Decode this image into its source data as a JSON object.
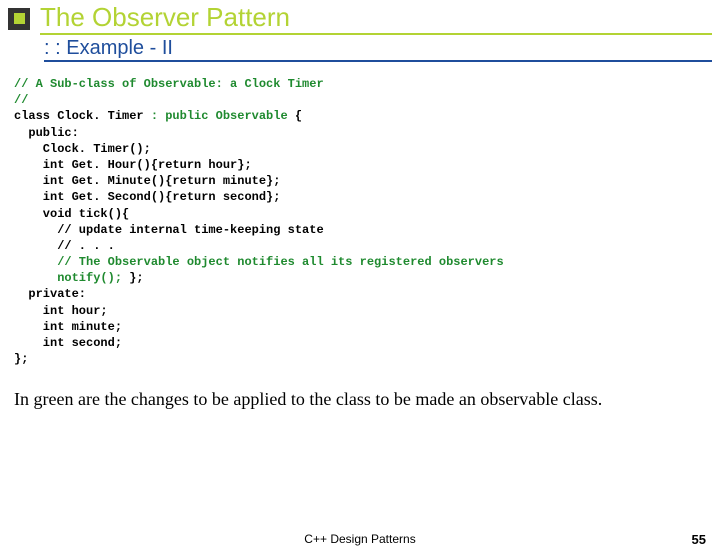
{
  "header": {
    "title": "The Observer Pattern",
    "subtitle": ": : Example - II"
  },
  "code": {
    "l01a": "// A Sub-class of Observable: a Clock Timer",
    "l02a": "//",
    "l03a": "class Clock. Timer ",
    "l03b": ": public Observable ",
    "l03c": "{",
    "l04a": "  public:",
    "l05a": "    Clock. Timer();",
    "l06a": "    int Get. Hour(){return hour};",
    "l07a": "    int Get. Minute(){return minute};",
    "l08a": "    int Get. Second(){return second};",
    "l09a": "    void tick(){",
    "l10a": "      // update internal time-keeping state",
    "l11a": "      // . . .",
    "l12a": "      // The Observable object notifies all its registered observers",
    "l13a": "      notify(); ",
    "l13b": "};",
    "l14a": "  private:",
    "l15a": "    int hour;",
    "l16a": "    int minute;",
    "l17a": "    int second;",
    "l18a": "};"
  },
  "explain": "In green are the changes to be applied to the class to be made an observable class.",
  "footer": {
    "center": "C++ Design Patterns",
    "page": "55"
  }
}
